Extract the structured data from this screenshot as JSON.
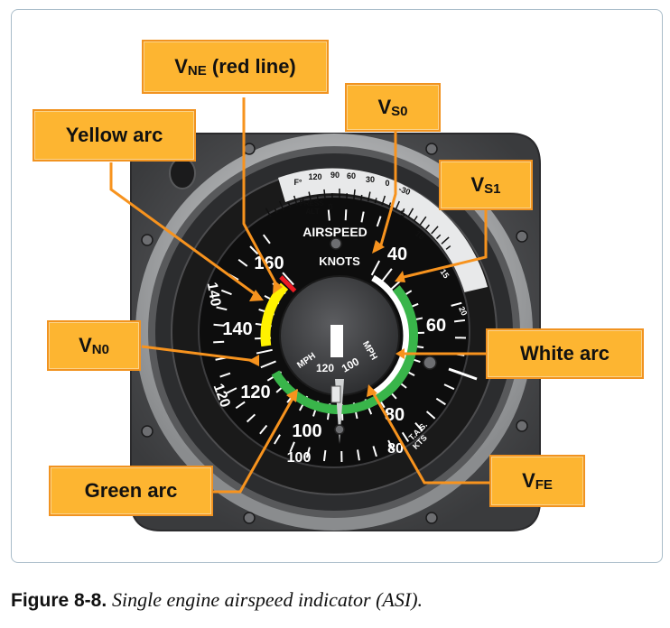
{
  "colors": {
    "callout_fill": "#fdb531",
    "callout_border": "#f19320",
    "leader": "#f7931e",
    "arc_white": "#ffffff",
    "arc_green": "#39b54a",
    "arc_yellow": "#fff200",
    "red_line": "#ed1c24"
  },
  "callouts": {
    "vne": {
      "main": "V",
      "sub": "NE",
      "suffix": " (red line)"
    },
    "yellow_arc": {
      "main": "Yellow arc"
    },
    "vs0": {
      "main": "V",
      "sub": "S0"
    },
    "vs1": {
      "main": "V",
      "sub": "S1"
    },
    "vno": {
      "main": "V",
      "sub": "N0"
    },
    "white_arc": {
      "main": "White arc"
    },
    "green_arc": {
      "main": "Green arc"
    },
    "vfe": {
      "main": "V",
      "sub": "FE"
    }
  },
  "dial": {
    "airspeed_label": "AIRSPEED",
    "knots_label": "KNOTS",
    "knots_numerals": [
      "40",
      "60",
      "80",
      "100",
      "120",
      "140",
      "160"
    ],
    "mph_numerals": [
      "80",
      "100",
      "120",
      "140"
    ],
    "tas_label": "T.A.S.",
    "kts_label": "KTS",
    "mph_label": "MPH",
    "inner_numerals": [
      "120",
      "100"
    ],
    "inner_mph_label": "MPH",
    "temp_label": "F°",
    "temp_numerals": [
      "120",
      "90",
      "60",
      "30",
      "0",
      "-30"
    ],
    "press_alt_label1": "PRESS",
    "press_alt_label2": "ALT",
    "press_alt_numerals": [
      "0",
      "5",
      "10",
      "15",
      "20"
    ]
  },
  "caption": {
    "label": "Figure 8-8.",
    "description": "Single engine airspeed indicator (ASI)."
  }
}
